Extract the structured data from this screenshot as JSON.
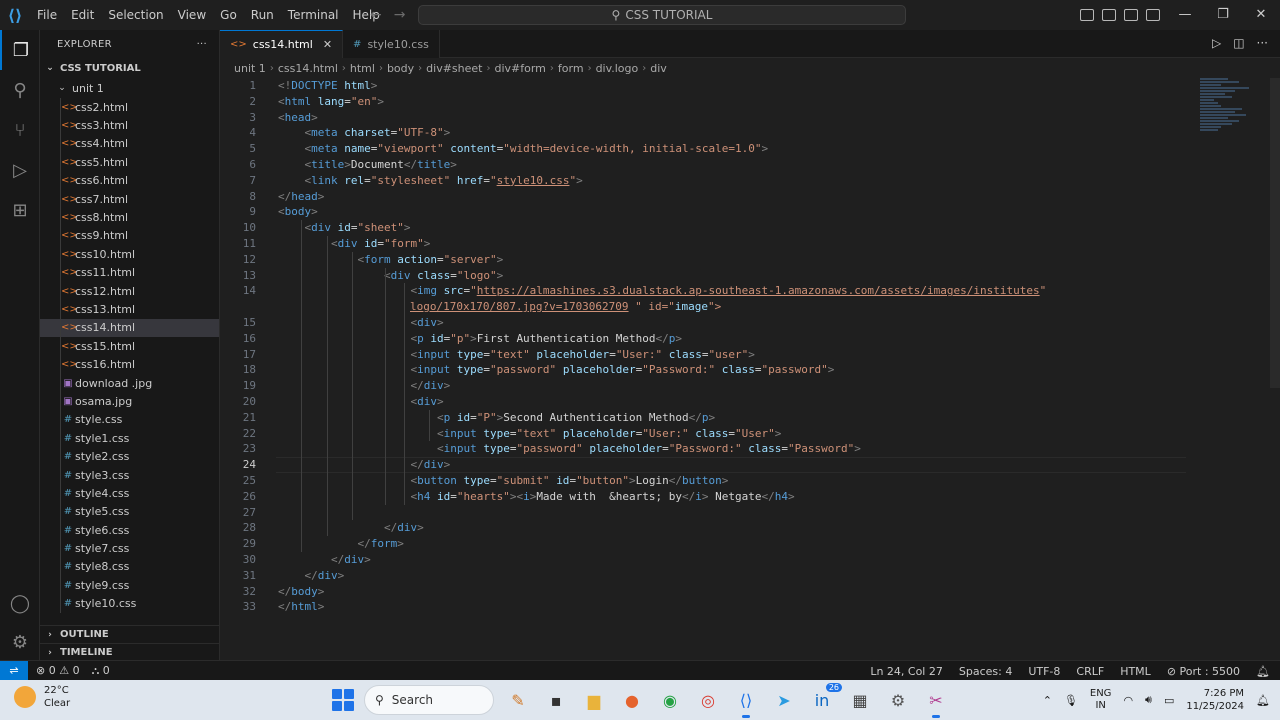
{
  "titlebar": {
    "menu": [
      "File",
      "Edit",
      "Selection",
      "View",
      "Go",
      "Run",
      "Terminal",
      "Help"
    ],
    "command_center": "CSS TUTORIAL"
  },
  "sidebar": {
    "title": "EXPLORER",
    "workspace": "CSS TUTORIAL",
    "folder": "unit 1",
    "files": [
      "css2.html",
      "css3.html",
      "css4.html",
      "css5.html",
      "css6.html",
      "css7.html",
      "css8.html",
      "css9.html",
      "css10.html",
      "css11.html",
      "css12.html",
      "css13.html",
      "css14.html",
      "css15.html",
      "css16.html",
      "download .jpg",
      "osama.jpg",
      "style.css",
      "style1.css",
      "style2.css",
      "style3.css",
      "style4.css",
      "style5.css",
      "style6.css",
      "style7.css",
      "style8.css",
      "style9.css",
      "style10.css"
    ],
    "selected_file": "css14.html",
    "outline": "OUTLINE",
    "timeline": "TIMELINE"
  },
  "tabs": [
    {
      "label": "css14.html",
      "active": true
    },
    {
      "label": "style10.css",
      "active": false
    }
  ],
  "breadcrumb": [
    "unit 1",
    "css14.html",
    "html",
    "body",
    "div#sheet",
    "div#form",
    "form",
    "div.logo",
    "div"
  ],
  "code_lines": [
    "<!DOCTYPE html>",
    "<html lang=\"en\">",
    "<head>",
    "    <meta charset=\"UTF-8\">",
    "    <meta name=\"viewport\" content=\"width=device-width, initial-scale=1.0\">",
    "    <title>Document</title>",
    "    <link rel=\"stylesheet\" href=\"style10.css\">",
    "</head>",
    "<body>",
    "    <div id=\"sheet\">",
    "        <div id=\"form\">",
    "            <form action=\"server\">",
    "                <div class=\"logo\">",
    "                    <img src=\"https://almashines.s3.dualstack.ap-southeast-1.amazonaws.com/assets/images/institutes/logo/170x170/807.jpg?v=1703062709\" id=\"image\">",
    "                    <div>",
    "                    <p id=\"p\">First Authentication Method</p>",
    "                    <input type=\"text\" placeholder=\"User:\" class=\"user\">",
    "                    <input type=\"password\" placeholder=\"Password:\" class=\"password\">",
    "                    </div>",
    "                    <div>",
    "                        <p id=\"P\">Second Authentication Method</p>",
    "                        <input type=\"text\" placeholder=\"User:\" class=\"User\">",
    "                        <input type=\"password\" placeholder=\"Password:\" class=\"Password\">",
    "                    </div>",
    "                    <button type=\"submit\" id=\"button\">Login</button>",
    "                    <h4 id=\"hearts\"><i>Made with  &hearts; by</i> Netgate</h4>",
    "",
    "                </div>",
    "            </form>",
    "        </div>",
    "    </div>",
    "</body>",
    "</html>"
  ],
  "current_line": 24,
  "status": {
    "errors": "0",
    "warnings": "0",
    "ports": "0",
    "position": "Ln 24, Col 27",
    "spaces": "Spaces: 4",
    "encoding": "UTF-8",
    "eol": "CRLF",
    "language": "HTML",
    "port": "Port : 5500"
  },
  "taskbar": {
    "temp": "22°C",
    "weather": "Clear",
    "search": "Search",
    "lang1": "ENG",
    "lang2": "IN",
    "time": "7:26 PM",
    "date": "11/25/2024",
    "badge": "26"
  }
}
